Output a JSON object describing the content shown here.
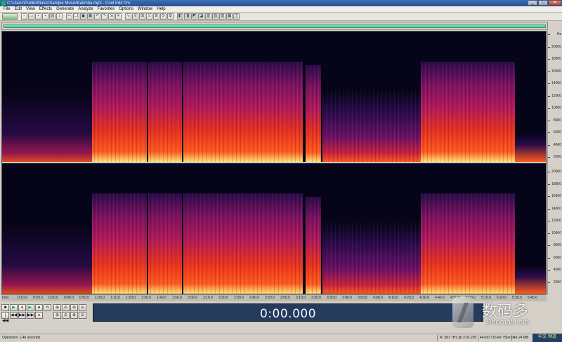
{
  "window": {
    "title": "C:\\Users\\Public\\Music\\Sample Music\\Kalimba.mp3 - Cool Edit Pro",
    "minimize": "_",
    "maximize": "□",
    "close": "✕"
  },
  "menu": [
    "File",
    "Edit",
    "View",
    "Effects",
    "Generate",
    "Analyze",
    "Favorites",
    "Options",
    "Window",
    "Help"
  ],
  "spectrogram": {
    "frequency_labels_top": [
      "Hz",
      "20000",
      "18000",
      "16000",
      "14000",
      "12000",
      "10000",
      "8000",
      "6000",
      "4000",
      "2000"
    ],
    "frequency_labels_bottom": [
      "20000",
      "18000",
      "16000",
      "14000",
      "12000",
      "10000",
      "8000",
      "6000",
      "4000",
      "2000"
    ],
    "colors": {
      "background": "#050418",
      "low": "#2a0b4a",
      "mid": "#b0195a",
      "high": "#ff5a1e",
      "peak": "#ffe37a"
    }
  },
  "time_ruler": {
    "labels": [
      "hms",
      "0:10.0",
      "0:20.0",
      "0:30.0",
      "0:40.0",
      "0:50.0",
      "1:00.0",
      "1:10.0",
      "1:20.0",
      "1:30.0",
      "1:40.0",
      "1:50.0",
      "2:00.0",
      "2:10.0",
      "2:20.0",
      "2:30.0",
      "2:40.0",
      "2:50.0",
      "3:00.0",
      "3:10.0",
      "3:20.0",
      "3:30.0",
      "3:40.0",
      "3:50.0",
      "4:00.0",
      "4:10.0",
      "4:20.0",
      "4:30.0",
      "4:40.0",
      "4:50.0",
      "5:00.0",
      "5:10.0",
      "5:20.0",
      "5:30.0",
      "5:40.0"
    ]
  },
  "transport": {
    "row1": [
      "■",
      "▶",
      "⏸",
      "▶|",
      "●",
      "⟲"
    ],
    "row2": [
      "|◀◀",
      "◀◀",
      "▶▶",
      "▶▶|",
      "●"
    ],
    "zoom_row1": [
      "⊕",
      "⊖",
      "⊕",
      "⊖"
    ],
    "zoom_row2": [
      "⊕",
      "⊖",
      "⊕",
      "⊖"
    ]
  },
  "time_display": "0:00.000",
  "watermark": {
    "cn": "数码多",
    "en": "Soomal.com",
    "stamp": "中文·频道"
  },
  "status": {
    "message": "Opened in 1.40 seconds",
    "position": "R: 381 7Hz @ 3:02.205",
    "format": "44100 ?16-bit ?Stereo",
    "size": "43.24 MB"
  }
}
